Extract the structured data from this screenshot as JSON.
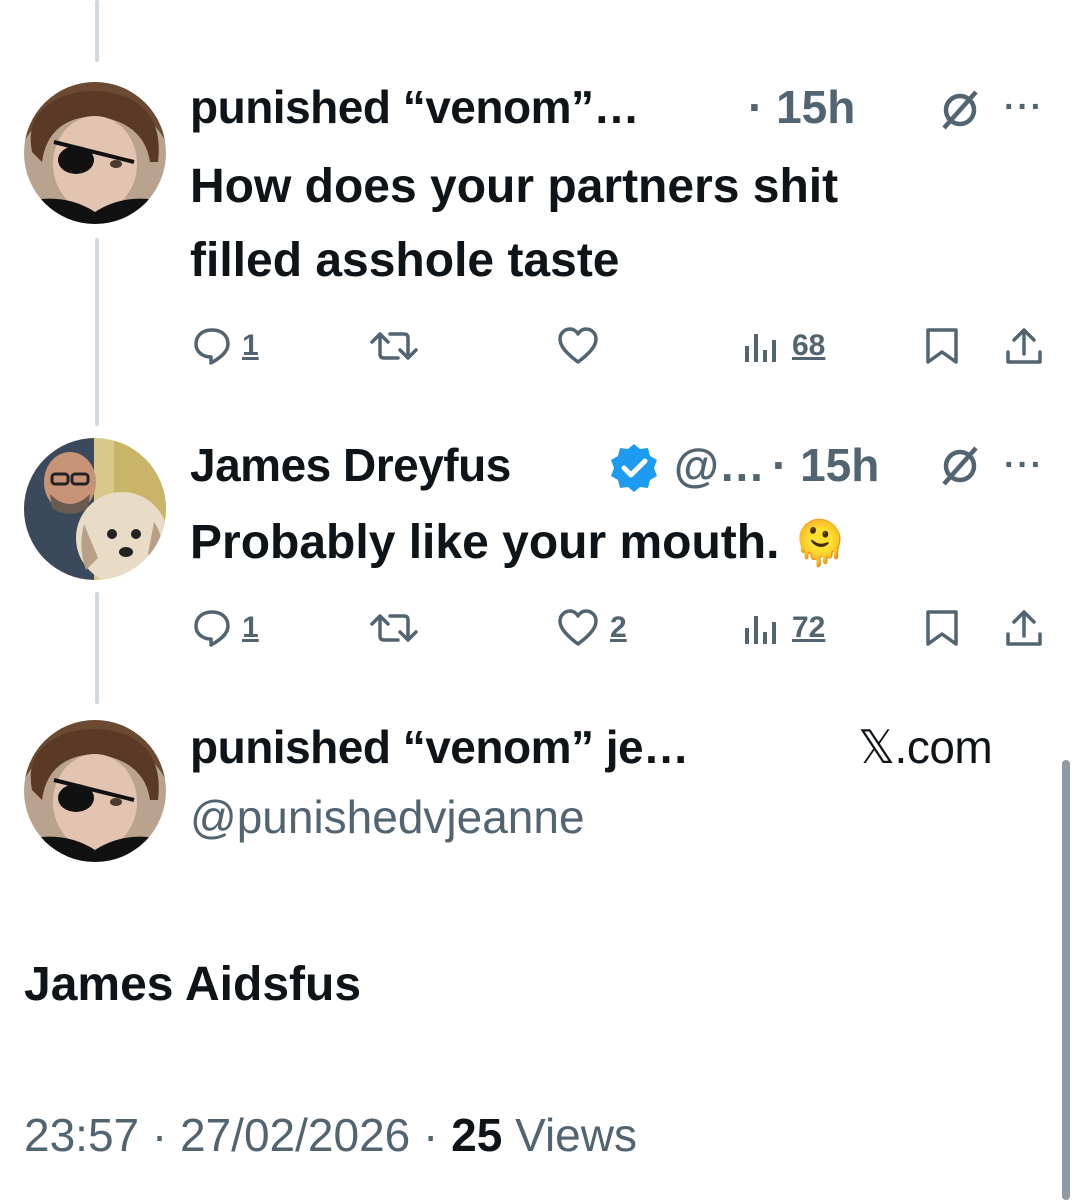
{
  "top_action_bar": {
    "partial": true
  },
  "tweets": [
    {
      "name": "punished “venom”…",
      "time": "· 15h",
      "text_line1": "How does your partners shit",
      "text_line2": "filled asshole taste",
      "replies": "1",
      "likes": "",
      "views": "68"
    },
    {
      "name": "James Dreyfus",
      "handle": "@…",
      "time": "· 15h",
      "text": "Probably like your mouth.",
      "emoji": "🫠",
      "replies": "1",
      "likes": "2",
      "views": "72"
    }
  ],
  "main_tweet": {
    "name": "punished “venom” je…",
    "site": "𝕏.com",
    "handle": "@punishedvjeanne",
    "text": "James Aidsfus",
    "time": "23:57",
    "date": "27/02/2026",
    "views_count": "25",
    "views_label": "Views"
  },
  "colors": {
    "text": "#0f1419",
    "muted": "#536471",
    "verified": "#1d9bf0",
    "thread_line": "#cfd9de"
  }
}
